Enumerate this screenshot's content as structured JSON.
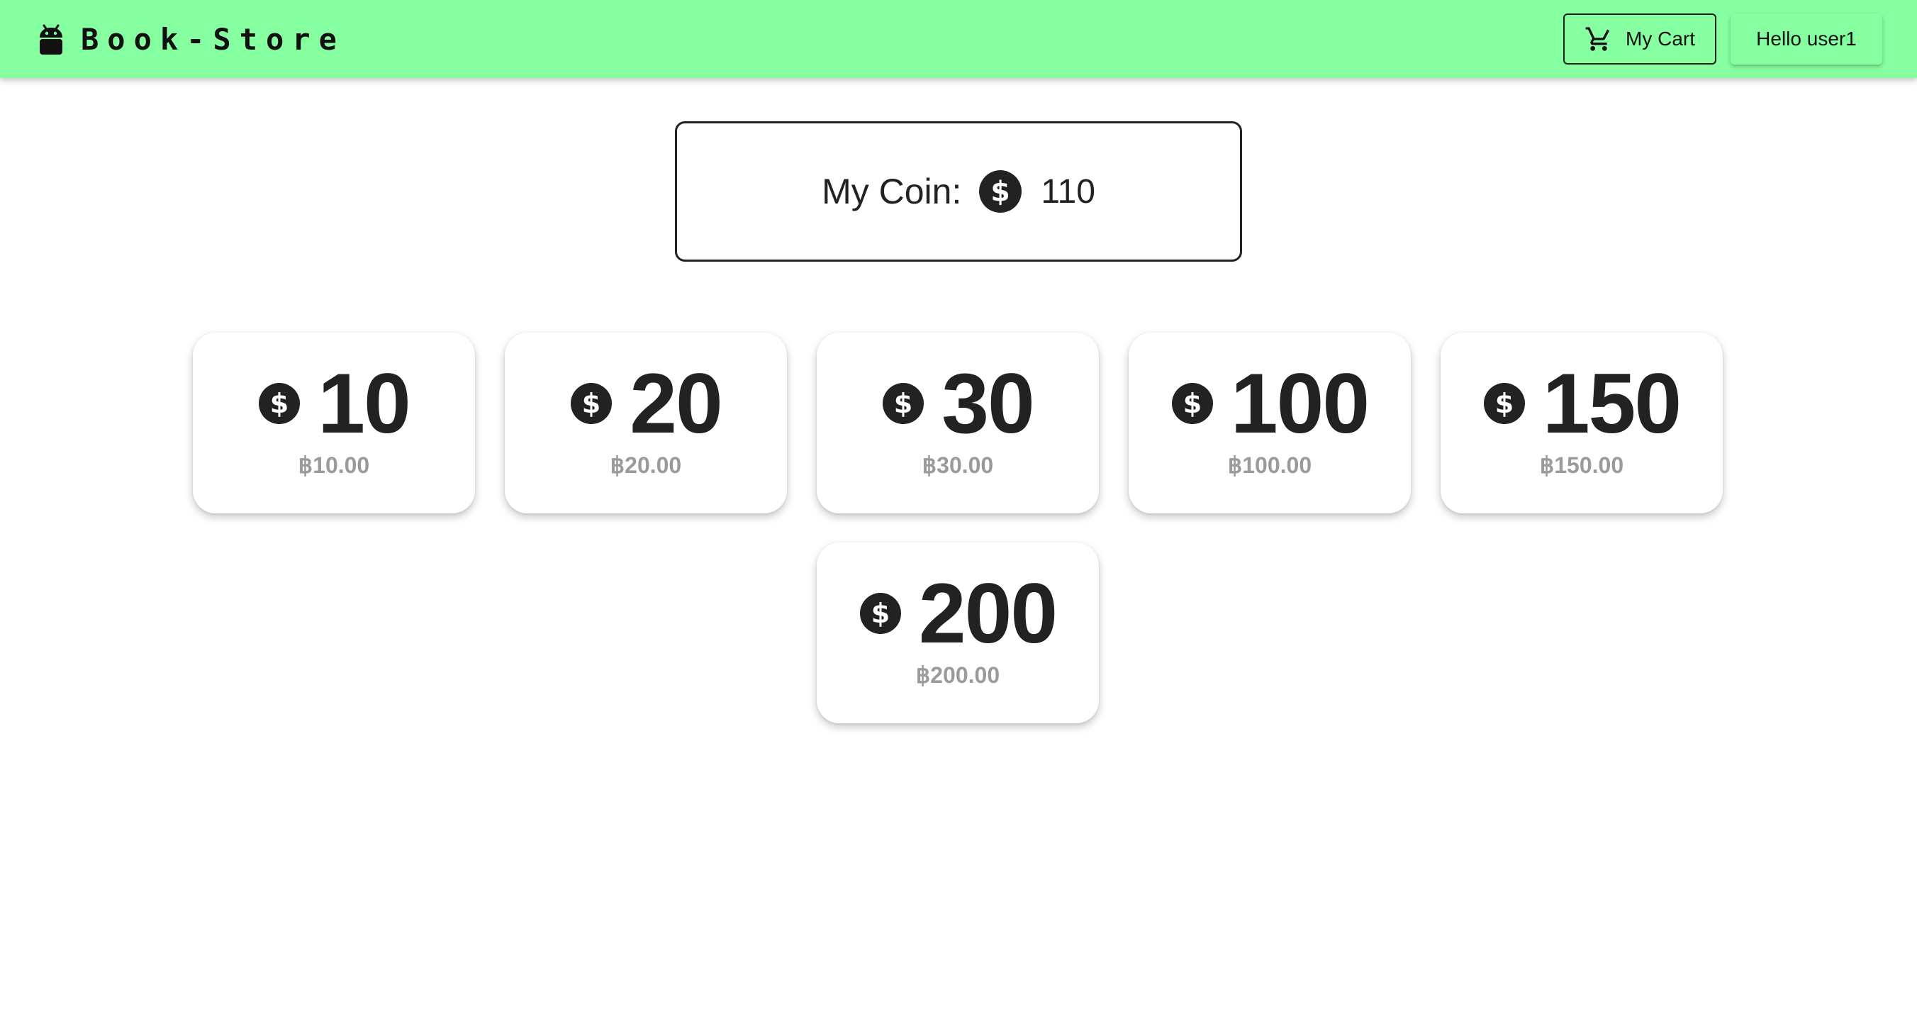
{
  "app": {
    "brand": "Book-Store"
  },
  "header": {
    "cart_label": "My Cart",
    "user_label": "Hello user1"
  },
  "wallet": {
    "label": "My Coin:",
    "balance": "110"
  },
  "coin_packages": [
    {
      "amount": "10",
      "price": "฿10.00"
    },
    {
      "amount": "20",
      "price": "฿20.00"
    },
    {
      "amount": "30",
      "price": "฿30.00"
    },
    {
      "amount": "100",
      "price": "฿100.00"
    },
    {
      "amount": "150",
      "price": "฿150.00"
    },
    {
      "amount": "200",
      "price": "฿200.00"
    }
  ],
  "icons": {
    "brand": "android-icon",
    "cart": "shopping-cart-icon",
    "coin": "dollar-coin-icon"
  },
  "colors": {
    "appbar": "#85ff9f",
    "text": "#222222",
    "price": "#9b9b9b"
  }
}
